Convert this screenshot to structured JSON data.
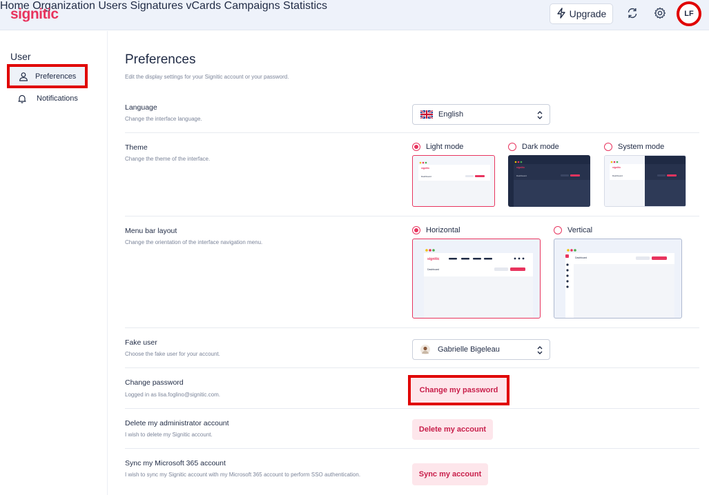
{
  "brand": {
    "logo": "signitic",
    "accent": "#e8345e"
  },
  "nav": {
    "items": [
      "Home",
      "Organization",
      "Users",
      "Signatures",
      "vCards",
      "Campaigns",
      "Statistics"
    ],
    "upgrade": "Upgrade",
    "avatar": "LF"
  },
  "sidebar": {
    "title": "User",
    "items": [
      {
        "label": "Preferences",
        "icon": "user-icon",
        "active": true
      },
      {
        "label": "Notifications",
        "icon": "bell-icon",
        "active": false
      }
    ]
  },
  "page": {
    "title": "Preferences",
    "subtitle": "Edit the display settings for your Signitic account or your password."
  },
  "language": {
    "label": "Language",
    "desc": "Change the interface language.",
    "value": "English"
  },
  "theme": {
    "label": "Theme",
    "desc": "Change the theme of the interface.",
    "options": [
      "Light mode",
      "Dark mode",
      "System mode"
    ],
    "selected": "Light mode",
    "preview_logo": "signitic",
    "preview_page": "Dashboard"
  },
  "menubar": {
    "label": "Menu bar layout",
    "desc": "Change the orientation of the interface navigation menu.",
    "options": [
      "Horizontal",
      "Vertical"
    ],
    "selected": "Horizontal",
    "preview_logo": "signitic",
    "preview_page": "Dashboard"
  },
  "fakeuser": {
    "label": "Fake user",
    "desc": "Choose the fake user for your account.",
    "value": "Gabrielle Bigeleau"
  },
  "password": {
    "label": "Change password",
    "desc": "Logged in as lisa.foglino@signitic.com.",
    "button": "Change my password"
  },
  "delete": {
    "label": "Delete my administrator account",
    "desc": "I wish to delete my Signitic account.",
    "button": "Delete my account"
  },
  "sync": {
    "label": "Sync my Microsoft 365 account",
    "desc": "I wish to sync my Signitic account with my Microsoft 365 account to perform SSO authentication.",
    "button": "Sync my account"
  }
}
